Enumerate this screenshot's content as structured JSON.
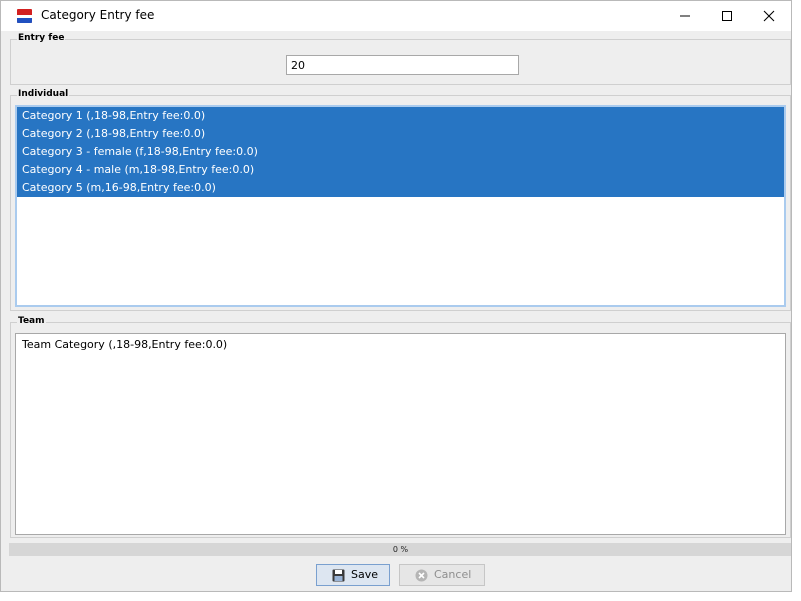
{
  "window": {
    "title": "Category Entry fee"
  },
  "entry_fee": {
    "label": "Entry fee",
    "value": "20"
  },
  "individual": {
    "label": "Individual",
    "items": [
      "Category 1 (,18-98,Entry fee:0.0)",
      "Category 2 (,18-98,Entry fee:0.0)",
      "Category 3 - female (f,18-98,Entry fee:0.0)",
      "Category 4 - male (m,18-98,Entry fee:0.0)",
      "Category 5 (m,16-98,Entry fee:0.0)"
    ]
  },
  "team": {
    "label": "Team",
    "items": [
      "Team Category (,18-98,Entry fee:0.0)"
    ]
  },
  "progress": {
    "text": "0 %",
    "value": 0
  },
  "buttons": {
    "save": "Save",
    "cancel": "Cancel"
  },
  "icons": {
    "app": "app-flag-icon",
    "minimize": "minimize-icon",
    "maximize": "maximize-icon",
    "close": "close-icon",
    "save": "floppy-disk-icon",
    "cancel": "cancel-circle-icon"
  },
  "colors": {
    "selection": "#2775c3",
    "selection_text": "#ffffff",
    "list_focus_border": "#aacbee"
  }
}
